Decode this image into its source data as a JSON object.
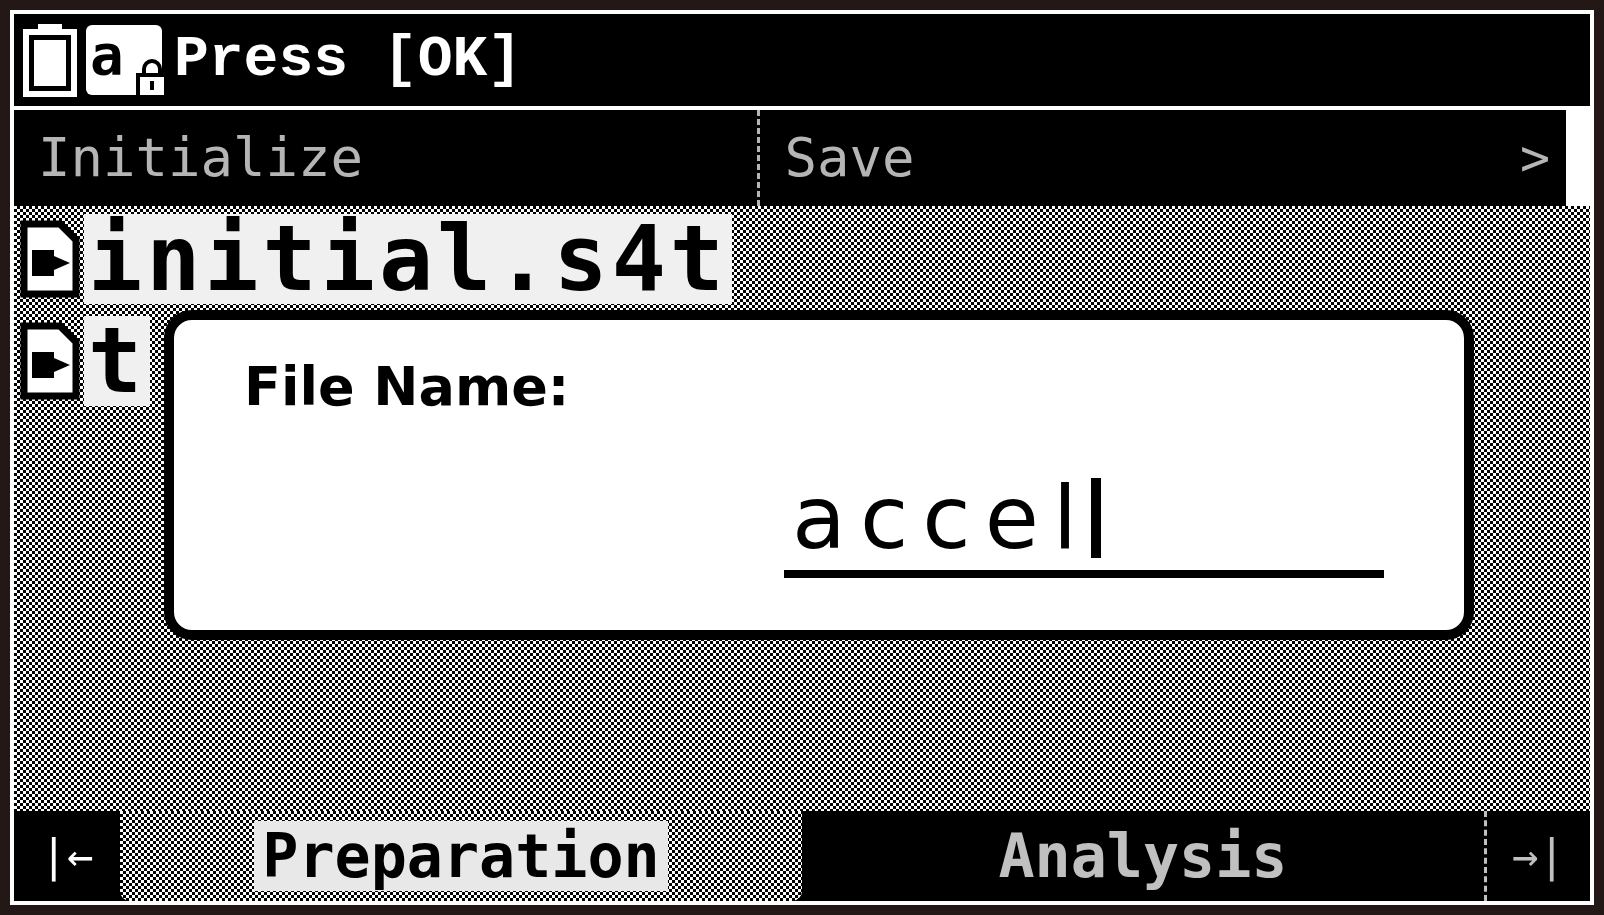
{
  "status_bar": {
    "message": "Press [OK]",
    "input_mode": "a"
  },
  "menu": [
    {
      "label": "Initialize",
      "disabled": true
    },
    {
      "label": "Save",
      "disabled": true
    }
  ],
  "menu_more": ">",
  "files": [
    {
      "name": "initial.s4t"
    },
    {
      "name": "t"
    }
  ],
  "dialog": {
    "label": "File Name:",
    "value": "accel"
  },
  "tabs": [
    {
      "label": "Preparation",
      "selected": true
    },
    {
      "label": "Analysis",
      "selected": false
    }
  ],
  "nav_first": "|←",
  "nav_last": "→|"
}
